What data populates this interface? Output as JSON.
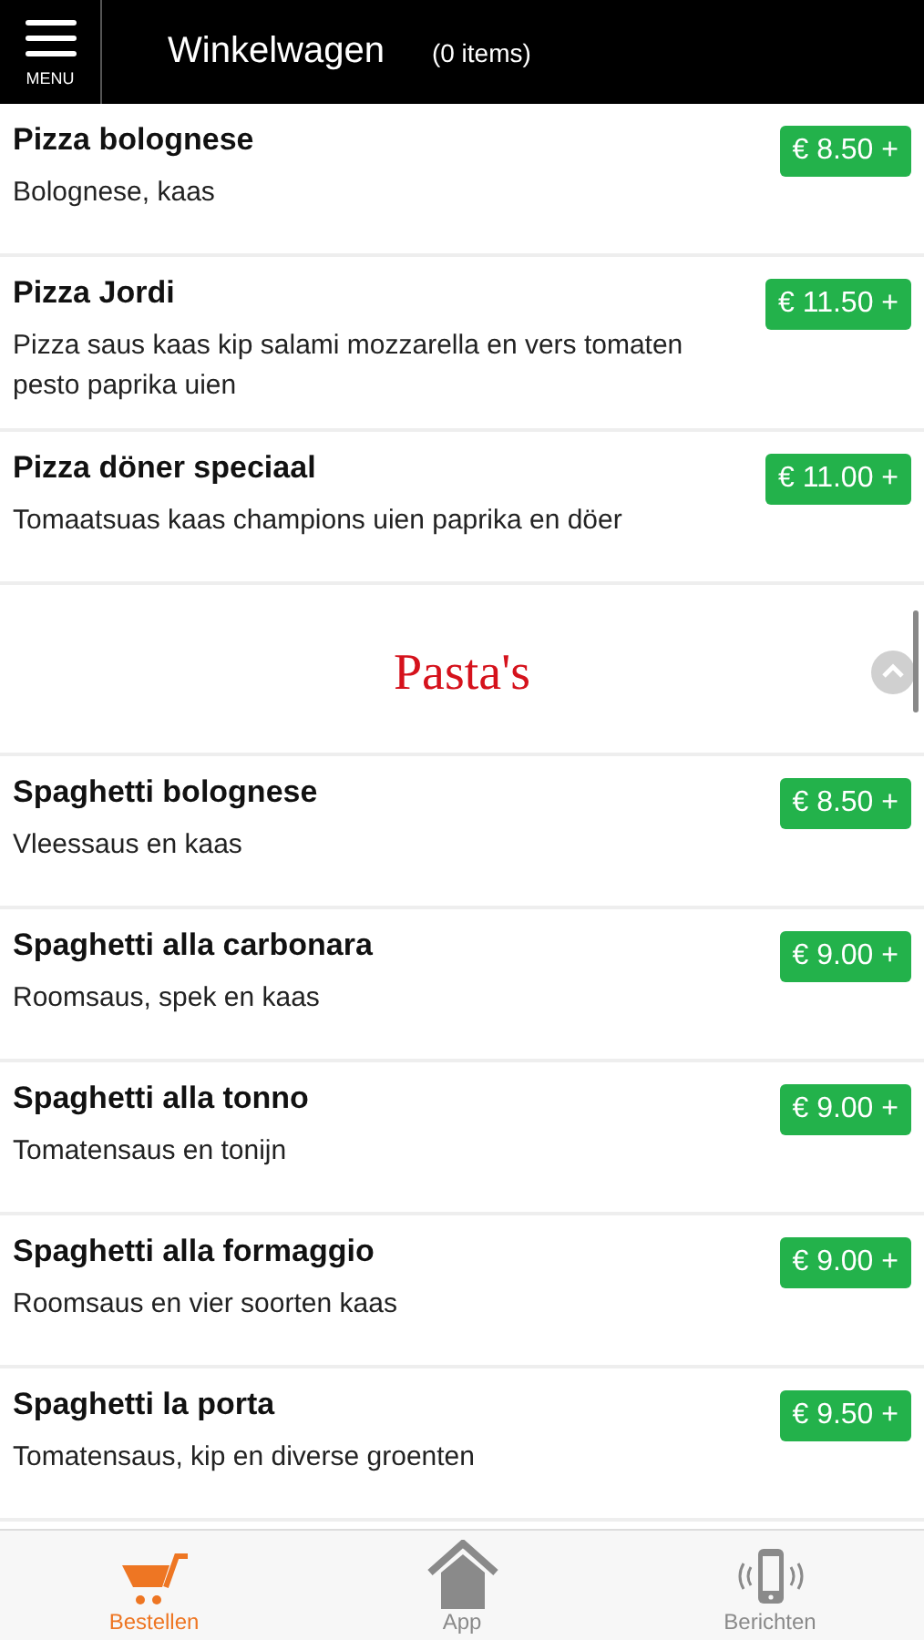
{
  "header": {
    "menu_label": "MENU",
    "title": "Winkelwagen",
    "count": "(0 items)"
  },
  "sections": [
    {
      "items": [
        {
          "name": "Pizza bolognese",
          "description": "Bolognese, kaas",
          "price": "€ 8.50 +"
        },
        {
          "name": "Pizza Jordi",
          "description": "Pizza saus kaas kip salami mozzarella en vers tomaten pesto paprika uien",
          "price": "€ 11.50 +"
        },
        {
          "name": "Pizza döner speciaal",
          "description": "Tomaatsuas kaas champions uien paprika en döer",
          "price": "€ 11.00 +"
        }
      ]
    },
    {
      "title": "Pasta's",
      "items": [
        {
          "name": "Spaghetti bolognese",
          "description": "Vleessaus en kaas",
          "price": "€ 8.50 +"
        },
        {
          "name": "Spaghetti alla carbonara",
          "description": "Roomsaus, spek en kaas",
          "price": "€ 9.00 +"
        },
        {
          "name": "Spaghetti alla tonno",
          "description": "Tomatensaus en tonijn",
          "price": "€ 9.00 +"
        },
        {
          "name": "Spaghetti alla formaggio",
          "description": "Roomsaus en vier soorten kaas",
          "price": "€ 9.00 +"
        },
        {
          "name": "Spaghetti la porta",
          "description": "Tomatensaus, kip en diverse groenten",
          "price": "€ 9.50 +"
        }
      ]
    }
  ],
  "tabs": [
    {
      "kind": "cart",
      "label": "Bestellen",
      "selected": true
    },
    {
      "kind": "home",
      "label": "App",
      "selected": false
    },
    {
      "kind": "phone",
      "label": "Berichten",
      "selected": false
    }
  ]
}
